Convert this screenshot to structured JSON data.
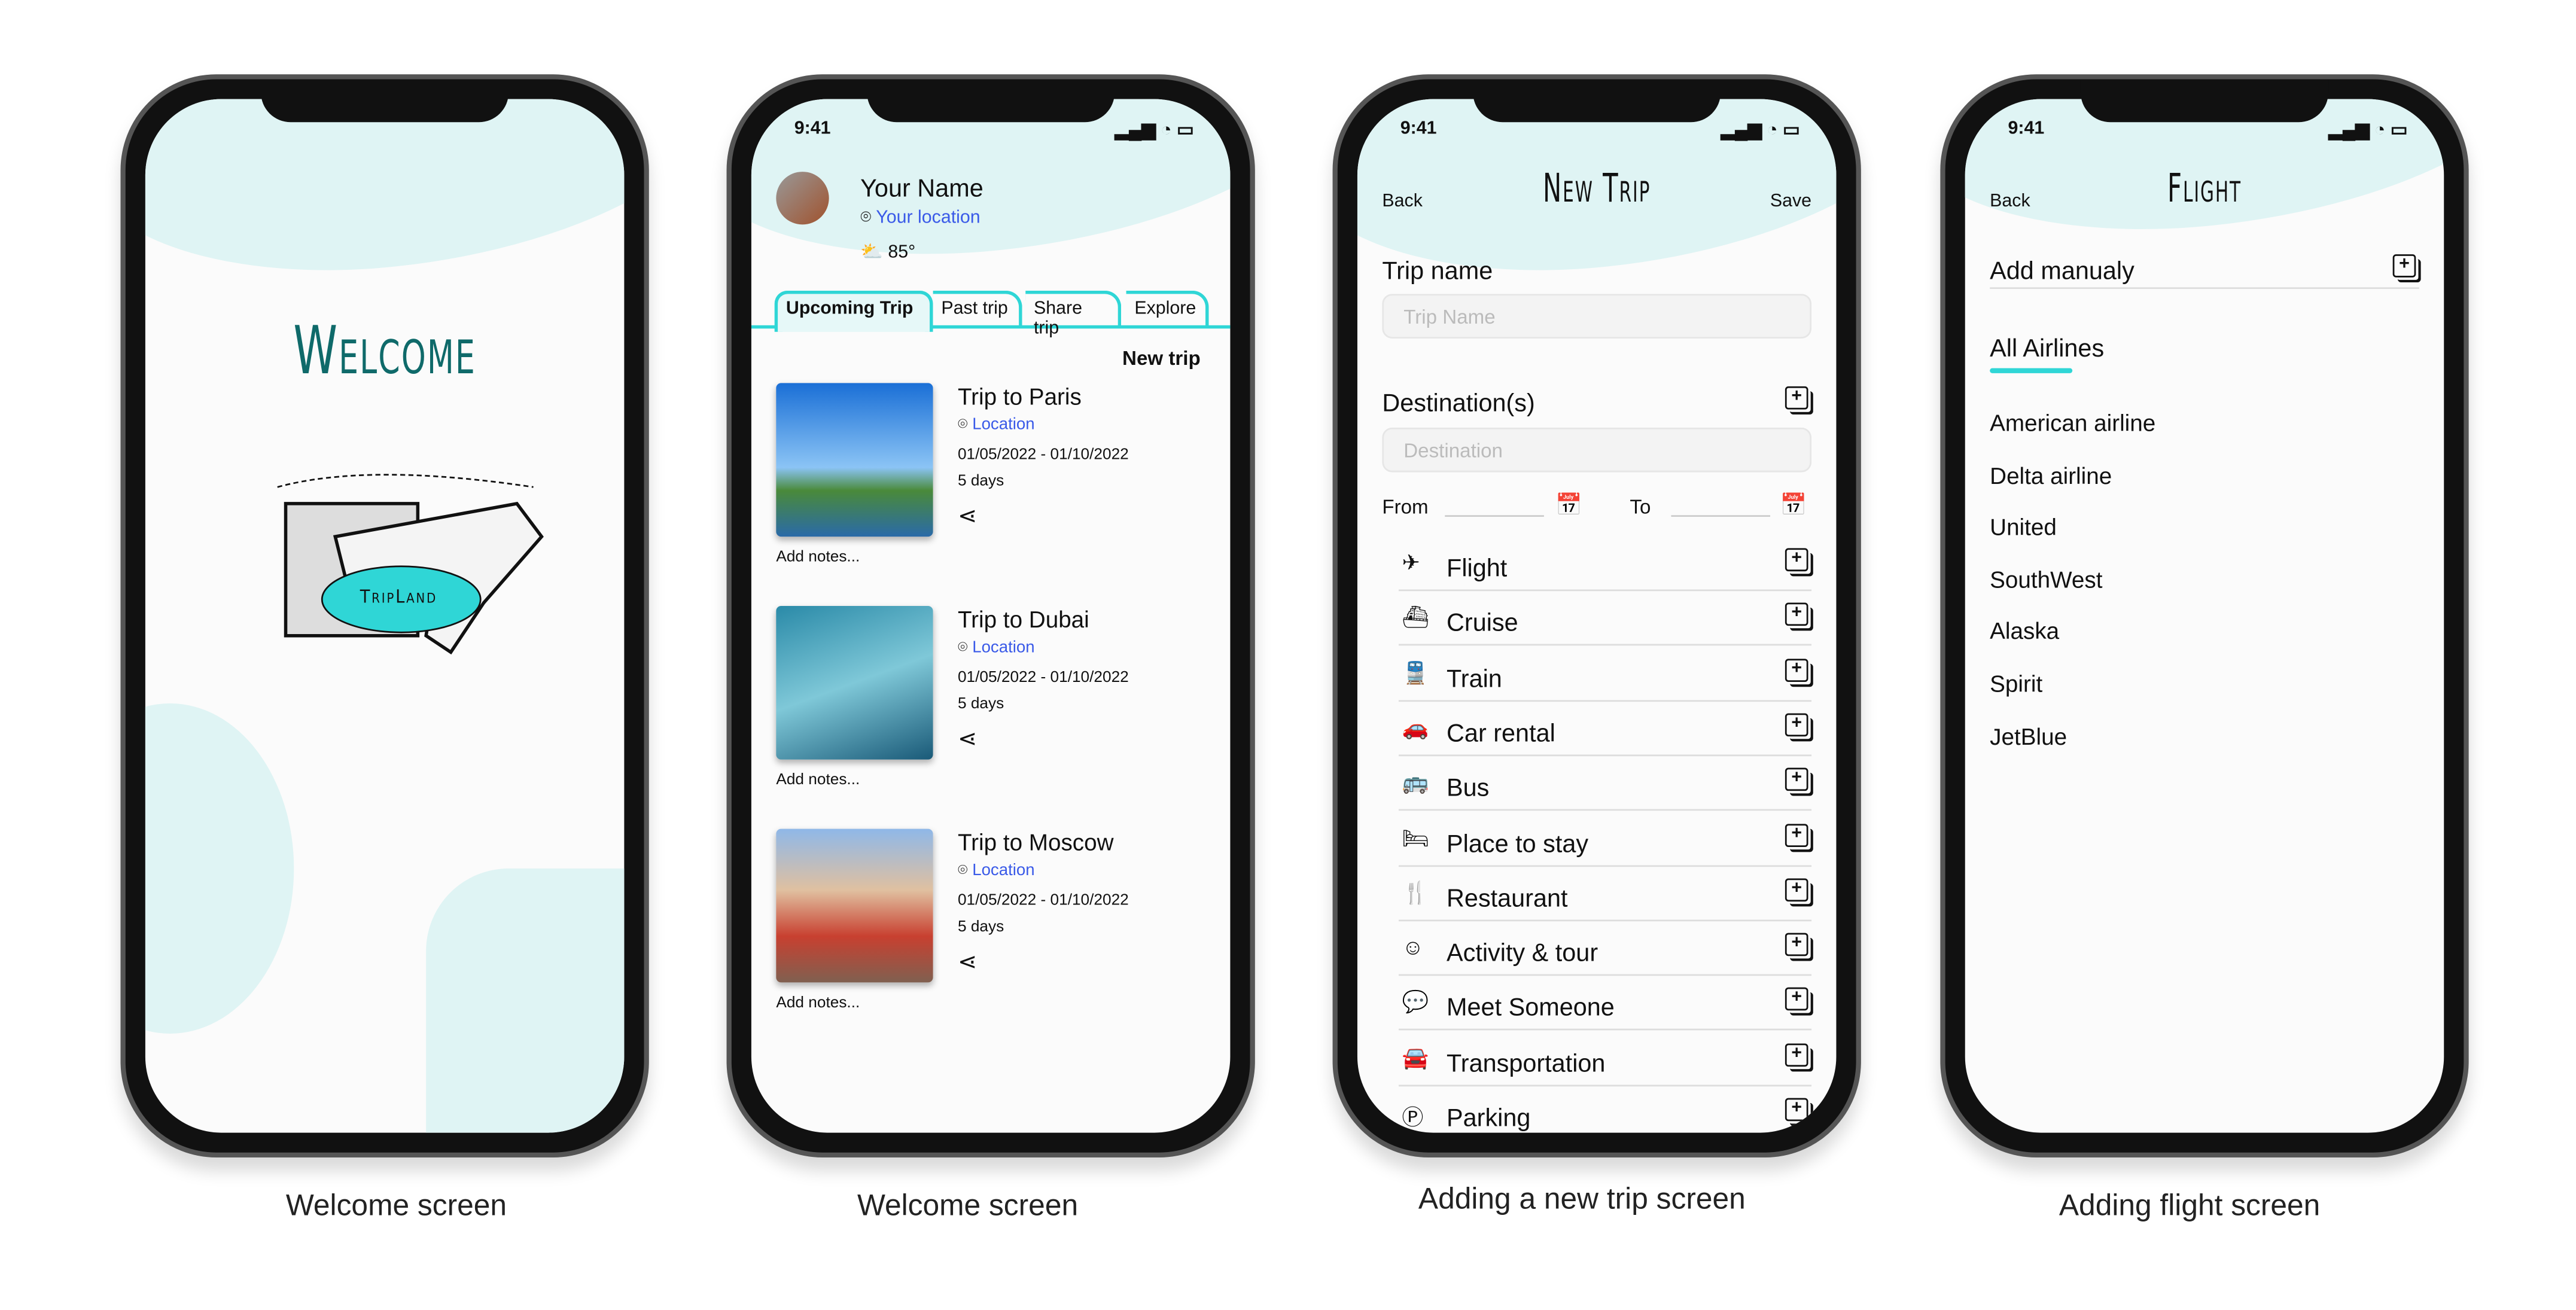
{
  "captions": [
    "Welcome screen",
    "Welcome screen",
    "Adding a new trip screen",
    "Adding flight screen"
  ],
  "status": {
    "time": "9:41"
  },
  "welcome": {
    "title": "Welcome",
    "logo_text": "TripLand"
  },
  "home": {
    "user_name": "Your Name",
    "user_location": "Your location",
    "weather": "85°",
    "tabs": [
      "Upcoming Trip",
      "Past trip",
      "Share trip",
      "Explore"
    ],
    "new_trip": "New trip",
    "trips": [
      {
        "title": "Trip to Paris",
        "location": "Location",
        "dates": "01/05/2022 - 01/10/2022",
        "duration": "5 days",
        "notes": "Add notes..."
      },
      {
        "title": "Trip to Dubai",
        "location": "Location",
        "dates": "01/05/2022 - 01/10/2022",
        "duration": "5 days",
        "notes": "Add notes..."
      },
      {
        "title": "Trip to Moscow",
        "location": "Location",
        "dates": "01/05/2022 - 01/10/2022",
        "duration": "5 days",
        "notes": "Add notes..."
      }
    ]
  },
  "new_trip": {
    "back": "Back",
    "title": "New Trip",
    "save": "Save",
    "trip_name_label": "Trip name",
    "trip_name_placeholder": "Trip Name",
    "destination_label": "Destination(s)",
    "destination_placeholder": "Destination",
    "from": "From",
    "to": "To",
    "categories": [
      {
        "label": "Flight",
        "icon": "✈"
      },
      {
        "label": "Cruise",
        "icon": "⛴"
      },
      {
        "label": "Train",
        "icon": "🚆"
      },
      {
        "label": "Car rental",
        "icon": "🚗"
      },
      {
        "label": "Bus",
        "icon": "🚌"
      },
      {
        "label": "Place to stay",
        "icon": "🛏"
      },
      {
        "label": "Restaurant",
        "icon": "🍴"
      },
      {
        "label": "Activity & tour",
        "icon": "☺"
      },
      {
        "label": "Meet Someone",
        "icon": "💬"
      },
      {
        "label": "Transportation",
        "icon": "🚘"
      },
      {
        "label": "Parking",
        "icon": "Ⓟ"
      }
    ]
  },
  "flight": {
    "back": "Back",
    "title": "Flight",
    "add_manually": "Add manualy",
    "all_airlines": "All Airlines",
    "airlines": [
      "American airline",
      "Delta airline",
      "United",
      "SouthWest",
      "Alaska",
      "Spirit",
      "JetBlue"
    ]
  },
  "colors": {
    "accent": "#2fd6d6",
    "header_bg": "#dff4f4",
    "link": "#3a5ae8"
  }
}
